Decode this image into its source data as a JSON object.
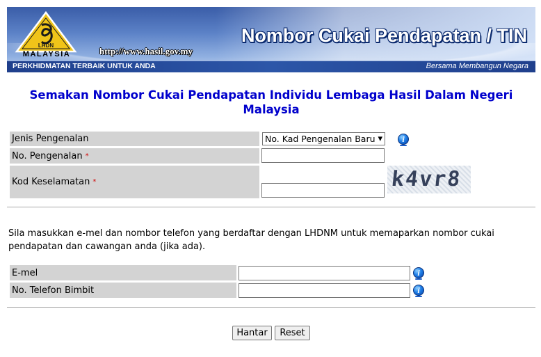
{
  "header": {
    "logo_text": "MALAYSIA",
    "logo_mark": "LHDN",
    "url": "http://www.hasil.gov.my",
    "title": "Nombor Cukai Pendapatan / TIN",
    "tagline_left": "PERKHIDMATAN TERBAIK UNTUK ANDA",
    "tagline_right": "Bersama Membangun Negara"
  },
  "page_title": "Semakan Nombor Cukai Pendapatan Individu Lembaga Hasil Dalam Negeri Malaysia",
  "form": {
    "id_type_label": "Jenis Pengenalan",
    "id_type_selected": "No. Kad Pengenalan Baru",
    "id_number_label": "No. Pengenalan",
    "id_number_value": "",
    "security_code_label": "Kod Keselamatan",
    "security_code_value": "",
    "captcha_text": "k4vr8",
    "required_mark": "*"
  },
  "info_text": "Sila masukkan e-mel dan nombor telefon yang berdaftar dengan LHDNM untuk memaparkan nombor cukai pendapatan dan cawangan anda (jika ada).",
  "contact": {
    "email_label": "E-mel",
    "email_value": "",
    "phone_label": "No. Telefon Bimbit",
    "phone_value": ""
  },
  "buttons": {
    "submit": "Hantar",
    "reset": "Reset"
  },
  "icons": {
    "info": "i",
    "dropdown": "▾"
  }
}
